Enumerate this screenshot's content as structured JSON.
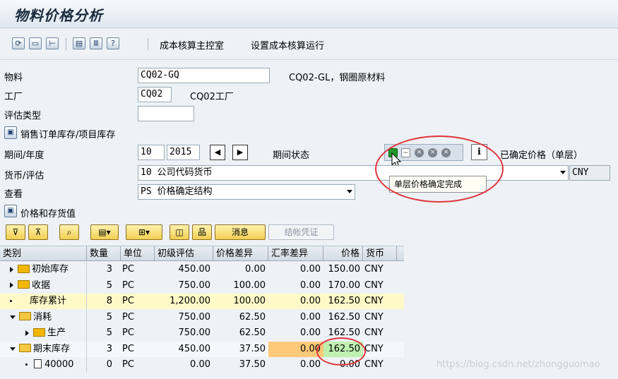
{
  "window": {
    "title": "物料价格分析"
  },
  "toolbar": {
    "icons": [
      "refresh-icon",
      "window-icon",
      "tree-icon",
      "screen-icon",
      "columns-icon",
      "help-icon"
    ],
    "menu1": "成本核算主控室",
    "menu2": "设置成本核算运行"
  },
  "form": {
    "material_label": "物料",
    "material_value": "CQ02-GQ",
    "material_desc": "CQ02-GL，钢圈原材料",
    "plant_label": "工厂",
    "plant_value": "CQ02",
    "plant_desc": "CQ02工厂",
    "valtype_label": "评估类型",
    "valtype_value": "",
    "sales_stock_label": "销售订单库存/项目库存",
    "period_label": "期间/年度",
    "period_value": "10",
    "year_value": "2015",
    "period_status_label": "期间状态",
    "status_text": "已确定价格（单层）",
    "currency_label": "货币/评估",
    "currency_value": "10 公司代码货币",
    "currency_code": "CNY",
    "view_label": "查看",
    "view_value": "PS 价格确定结构",
    "tooltip": "单层价格确定完成",
    "price_stock_label": "价格和存货值"
  },
  "grid_toolbar": {
    "message_btn": "消息",
    "close_voucher_btn": "结帐凭证"
  },
  "grid": {
    "headers": [
      "类别",
      "数量",
      "单位",
      "初级评估",
      "价格差异",
      "汇率差异",
      "价格",
      "货币"
    ],
    "rows": [
      {
        "cat": "初始库存",
        "qty": "3",
        "unit": "PC",
        "prim": "450.00",
        "pdiff": "0.00",
        "xdiff": "0.00",
        "price": "150.00",
        "cur": "CNY"
      },
      {
        "cat": "收据",
        "qty": "5",
        "unit": "PC",
        "prim": "750.00",
        "pdiff": "100.00",
        "xdiff": "0.00",
        "price": "170.00",
        "cur": "CNY"
      },
      {
        "cat": "库存累计",
        "qty": "8",
        "unit": "PC",
        "prim": "1,200.00",
        "pdiff": "100.00",
        "xdiff": "0.00",
        "price": "162.50",
        "cur": "CNY"
      },
      {
        "cat": "消耗",
        "qty": "5",
        "unit": "PC",
        "prim": "750.00",
        "pdiff": "62.50",
        "xdiff": "0.00",
        "price": "162.50",
        "cur": "CNY"
      },
      {
        "cat": "生产",
        "qty": "5",
        "unit": "PC",
        "prim": "750.00",
        "pdiff": "62.50",
        "xdiff": "0.00",
        "price": "162.50",
        "cur": "CNY"
      },
      {
        "cat": "期末库存",
        "qty": "3",
        "unit": "PC",
        "prim": "450.00",
        "pdiff": "37.50",
        "xdiff": "0.00",
        "price": "162.50",
        "cur": "CNY"
      },
      {
        "cat": "40000",
        "qty": "0",
        "unit": "PC",
        "prim": "0.00",
        "pdiff": "37.50",
        "xdiff": "0.00",
        "price": "0.00",
        "cur": "CNY"
      }
    ]
  },
  "watermark": "https://blog.csdn.net/zhongguomao",
  "colors": {
    "highlight_row": "#fff9c8",
    "highlight_orange": "#ffc97a",
    "highlight_green": "#bff0b0",
    "circle_red": "#e0353c"
  }
}
